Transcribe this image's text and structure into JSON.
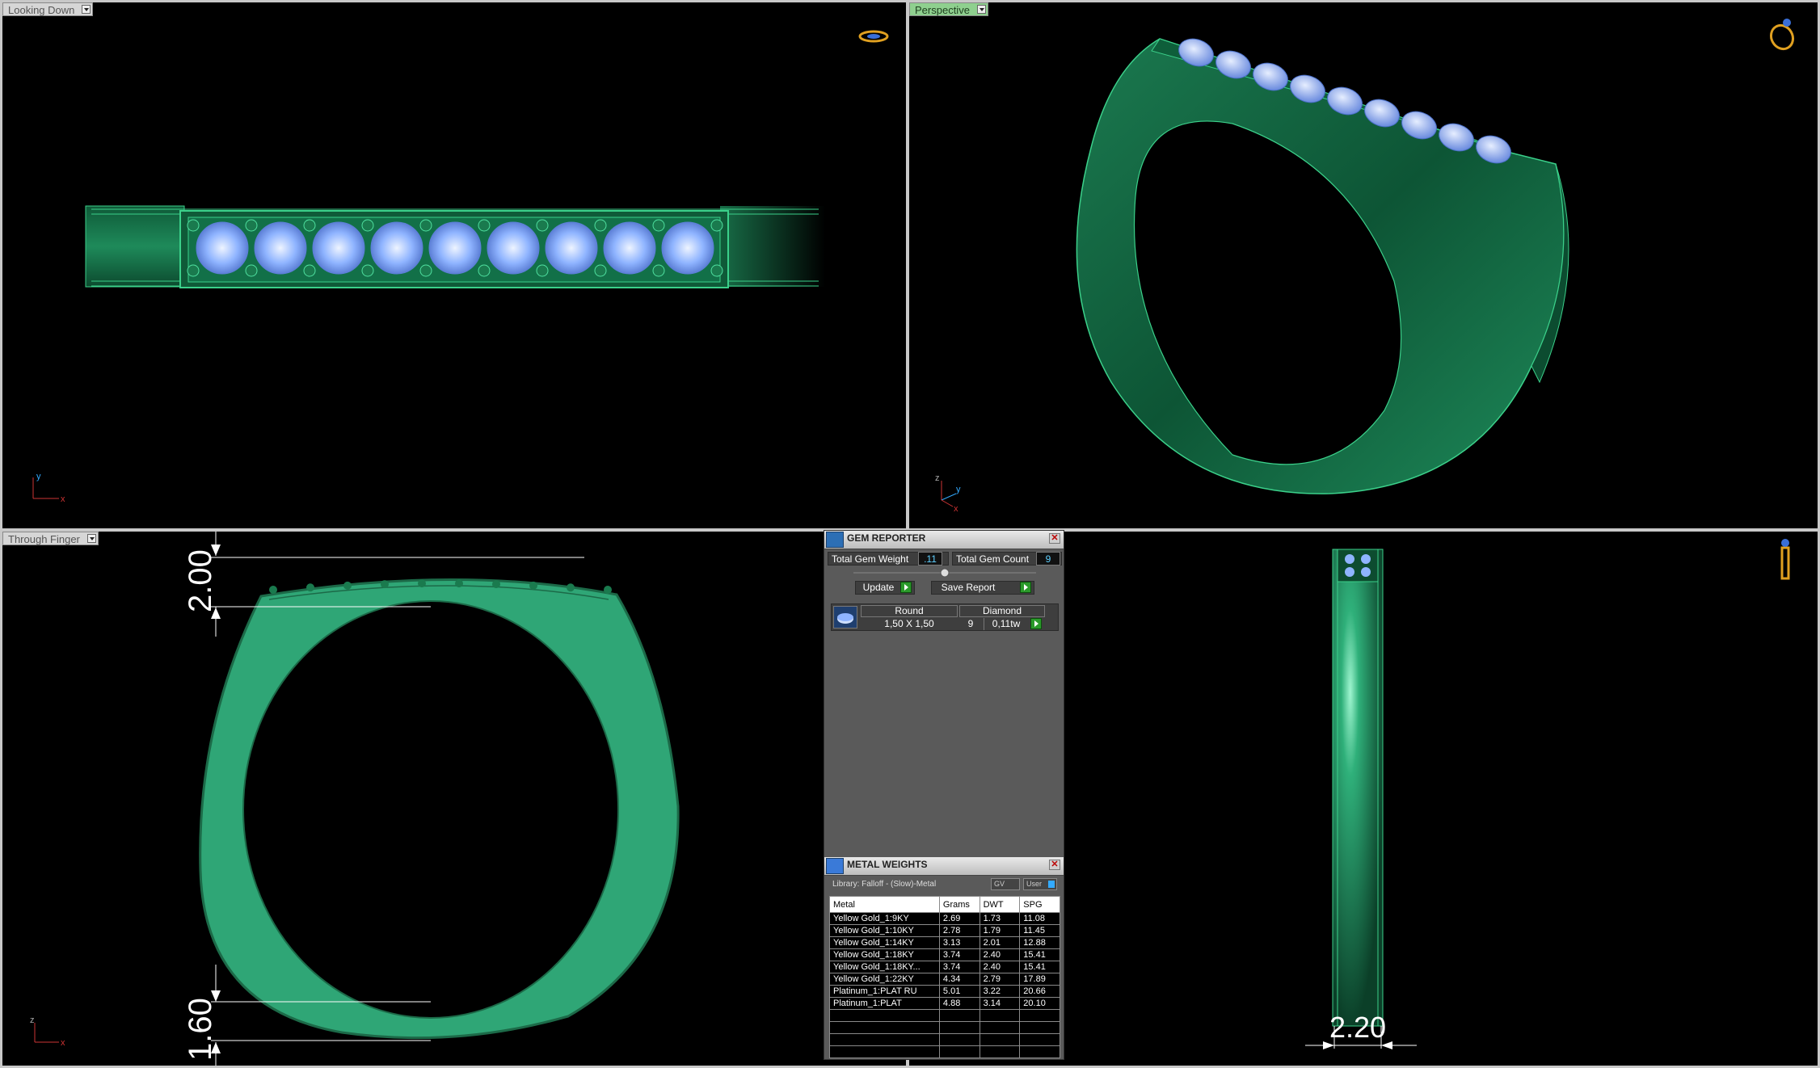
{
  "viewports": {
    "top_left": {
      "label": "Looking Down",
      "axis": {
        "a": "y",
        "b": "x"
      }
    },
    "top_right": {
      "label": "Perspective",
      "axis": {
        "a": "z",
        "b": "y",
        "c": "x"
      }
    },
    "bottom_left": {
      "label": "Through Finger",
      "axis": {
        "a": "z",
        "b": "x"
      },
      "dim_top": "2.00",
      "dim_bottom": "1.60"
    },
    "bottom_right": {
      "dim_width": "2.20"
    }
  },
  "gem_reporter": {
    "title": "GEM REPORTER",
    "total_weight_label": "Total Gem Weight",
    "total_weight_value": ".11",
    "total_count_label": "Total Gem Count",
    "total_count_value": "9",
    "update_label": "Update",
    "save_label": "Save Report",
    "gem_table": {
      "shape": "Round",
      "type": "Diamond",
      "size": "1,50 X 1,50",
      "count": "9",
      "weight": "0,11tw"
    }
  },
  "metal_weights": {
    "title": "METAL WEIGHTS",
    "library": "Library: Falloff - (Slow)-Metal",
    "gv_label": "GV",
    "user_label": "User",
    "columns": [
      "Metal",
      "Grams",
      "DWT",
      "SPG"
    ],
    "rows": [
      [
        "Yellow Gold_1:9KY",
        "2.69",
        "1.73",
        "11.08"
      ],
      [
        "Yellow Gold_1:10KY",
        "2.78",
        "1.79",
        "11.45"
      ],
      [
        "Yellow Gold_1:14KY",
        "3.13",
        "2.01",
        "12.88"
      ],
      [
        "Yellow Gold_1:18KY",
        "3.74",
        "2.40",
        "15.41"
      ],
      [
        "Yellow Gold_1:18KY...",
        "3.74",
        "2.40",
        "15.41"
      ],
      [
        "Yellow Gold_1:22KY",
        "4.34",
        "2.79",
        "17.89"
      ],
      [
        "Platinum_1:PLAT RU",
        "5.01",
        "3.22",
        "20.66"
      ],
      [
        "Platinum_1:PLAT",
        "4.88",
        "3.14",
        "20.10"
      ]
    ]
  },
  "colors": {
    "metal": "#1e8a5a",
    "metal_light": "#3aa57c",
    "gem": "#8fb4ff",
    "viewport_bg": "#000000"
  }
}
